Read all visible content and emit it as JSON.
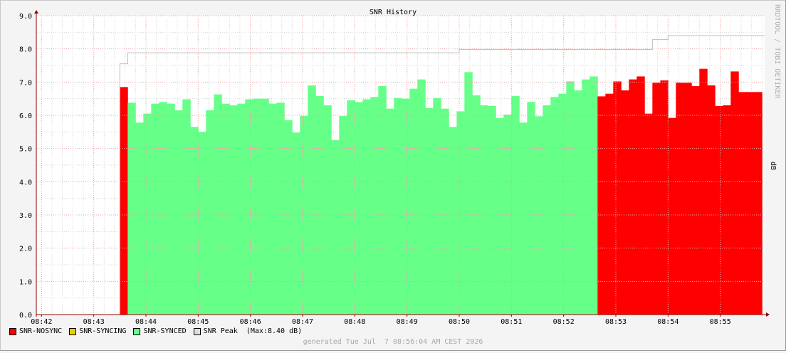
{
  "watermark": "RRDTOOL / TOBI OETIKER",
  "footer": "generated Tue Jul  7 08:56:04 AM CEST 2026",
  "colors": {
    "nosync": "#ff0000",
    "syncing": "#e8d000",
    "synced": "#66ff88",
    "peak": "#bdbdbd",
    "grid_major": "#e9a8a8",
    "grid_minor": "#d8d8d8",
    "axis": "#8b0000",
    "canvas": "#ffffff"
  },
  "legend": [
    {
      "label": "SNR-NOSYNC",
      "color": "#ff0000"
    },
    {
      "label": "SNR-SYNCING",
      "color": "#e8d000"
    },
    {
      "label": "SNR-SYNCED",
      "color": "#66ff88"
    },
    {
      "label": "SNR Peak  (Max:8.40 dB)",
      "color": "#dddddd"
    }
  ],
  "chart_data": {
    "type": "area",
    "title": "SNR History",
    "ylabel": "dB",
    "xlabel": "",
    "ylim": [
      0,
      9
    ],
    "yticks": [
      "0.0",
      "1.0",
      "2.0",
      "3.0",
      "4.0",
      "5.0",
      "6.0",
      "7.0",
      "8.0",
      "9.0"
    ],
    "xticks": [
      "08:42",
      "08:43",
      "08:44",
      "08:45",
      "08:46",
      "08:47",
      "08:48",
      "08:49",
      "08:50",
      "08:51",
      "08:52",
      "08:53",
      "08:54",
      "08:55"
    ],
    "xlim_minutes": [
      41.9,
      55.85
    ],
    "legend_position": "bottom",
    "grid": true,
    "series": [
      {
        "name": "SNR-NOSYNC",
        "x_minutes": [
          43.5
        ],
        "values": [
          6.85
        ]
      },
      {
        "name": "SNR-SYNCED",
        "x_minutes": [
          43.65,
          43.8,
          43.95,
          44.1,
          44.25,
          44.4,
          44.55,
          44.7,
          44.85,
          45.0,
          45.15,
          45.3,
          45.45,
          45.6,
          45.75,
          45.9,
          46.05,
          46.2,
          46.35,
          46.5,
          46.65,
          46.8,
          46.95,
          47.1,
          47.25,
          47.4,
          47.55,
          47.7,
          47.85,
          48.0,
          48.15,
          48.3,
          48.45,
          48.6,
          48.75,
          48.9,
          49.05,
          49.2,
          49.35,
          49.5,
          49.65,
          49.8,
          49.95,
          50.1,
          50.25,
          50.4,
          50.55,
          50.7,
          50.85,
          51.0,
          51.15,
          51.3,
          51.45,
          51.6,
          51.75,
          51.9,
          52.05,
          52.2,
          52.35,
          52.5
        ],
        "values": [
          6.38,
          5.78,
          6.05,
          6.35,
          6.4,
          6.35,
          6.15,
          6.48,
          5.65,
          5.5,
          6.15,
          6.63,
          6.35,
          6.3,
          6.35,
          6.48,
          6.5,
          6.5,
          6.35,
          6.38,
          5.85,
          5.48,
          5.98,
          6.9,
          6.58,
          6.3,
          5.25,
          5.98,
          6.45,
          6.4,
          6.48,
          6.55,
          6.88,
          6.2,
          6.52,
          6.5,
          6.8,
          7.08,
          6.22,
          6.52,
          6.2,
          5.65,
          6.12,
          7.3,
          6.6,
          6.3,
          6.28,
          5.92,
          6.02,
          6.58,
          5.78,
          6.4,
          5.97,
          6.3,
          6.55,
          6.65,
          7.02,
          6.75,
          7.08,
          7.17
        ]
      },
      {
        "name": "SNR-NOSYNC",
        "x_minutes": [
          52.65,
          52.8,
          52.95,
          53.1,
          53.25,
          53.4,
          53.55,
          53.7,
          53.85,
          54.0,
          54.15,
          54.3,
          54.45,
          54.6,
          54.75,
          54.9,
          55.05,
          55.2,
          55.35,
          55.5,
          55.65
        ],
        "values": [
          6.57,
          6.65,
          7.02,
          6.75,
          7.08,
          7.17,
          6.05,
          6.98,
          7.05,
          5.92,
          6.98,
          6.98,
          6.88,
          7.4,
          6.9,
          6.28,
          6.3,
          7.32,
          6.7,
          6.7,
          6.7
        ]
      },
      {
        "name": "SNR Peak",
        "x_minutes": [
          43.5,
          43.65,
          50.0,
          53.7,
          54.0,
          55.85
        ],
        "values": [
          7.55,
          7.88,
          7.98,
          8.28,
          8.4,
          8.4
        ]
      }
    ]
  }
}
